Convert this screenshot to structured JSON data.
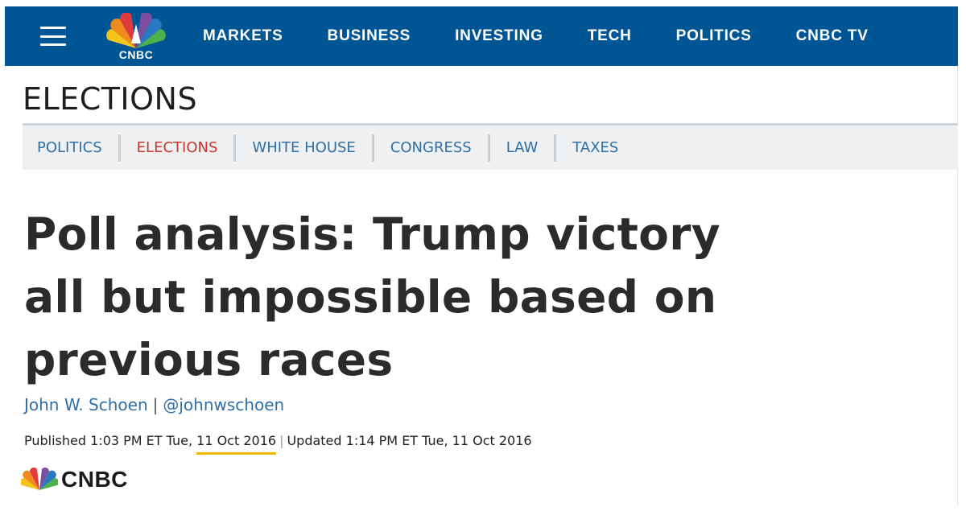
{
  "colors": {
    "nav_bg": "#005594",
    "link_blue": "#2f6fa5",
    "active_red": "#c9362f",
    "highlight_yellow": "#f2b705"
  },
  "topnav": {
    "logo_text": "CNBC",
    "links": [
      "MARKETS",
      "BUSINESS",
      "INVESTING",
      "TECH",
      "POLITICS",
      "CNBC TV"
    ]
  },
  "section": {
    "title": "ELECTIONS",
    "subnav": [
      "POLITICS",
      "ELECTIONS",
      "WHITE HOUSE",
      "CONGRESS",
      "LAW",
      "TAXES"
    ],
    "active": "ELECTIONS"
  },
  "article": {
    "headline": "Poll analysis: Trump victory all but impossible based on previous races",
    "author": "John W. Schoen",
    "author_handle": "@johnwschoen",
    "published_prefix": "Published 1:03 PM ET Tue, ",
    "published_date": "11 Oct 2016",
    "updated": "Updated 1:14 PM ET Tue, 11 Oct 2016"
  },
  "footer": {
    "logo_text": "CNBC"
  },
  "icons": {
    "menu": "hamburger-menu-icon",
    "logo": "peacock-logo-icon"
  }
}
